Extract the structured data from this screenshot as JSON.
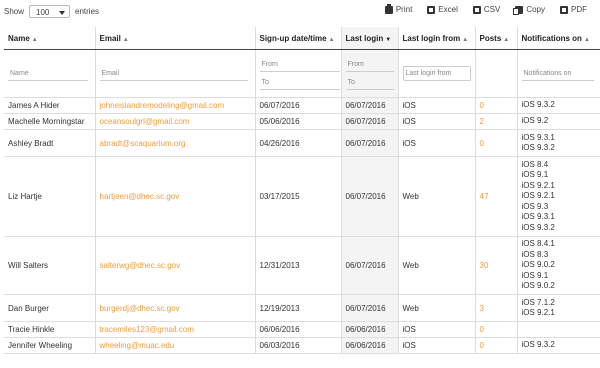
{
  "length_menu": {
    "show_label": "Show",
    "value": "100",
    "entries_label": "entries"
  },
  "toolbar": [
    {
      "icon": "print-icon",
      "label": "Print"
    },
    {
      "icon": "excel-icon",
      "label": "Excel"
    },
    {
      "icon": "csv-icon",
      "label": "CSV"
    },
    {
      "icon": "copy-icon",
      "label": "Copy"
    },
    {
      "icon": "pdf-icon",
      "label": "PDF"
    }
  ],
  "columns": [
    {
      "label": "Name",
      "sort": "▲"
    },
    {
      "label": "Email",
      "sort": "▲"
    },
    {
      "label": "Sign-up date/time",
      "sort": "▲"
    },
    {
      "label": "Last login",
      "sort": "▼"
    },
    {
      "label": "Last login from",
      "sort": "▲"
    },
    {
      "label": "Posts",
      "sort": "▲"
    },
    {
      "label": "Notifications on",
      "sort": "▲"
    }
  ],
  "filters": {
    "name": "Name",
    "email": "Email",
    "signup_from": "From",
    "signup_to": "To",
    "lastlogin_from": "From",
    "lastlogin_to": "To",
    "lastloginfrom": "Last login from",
    "notifications": "Notifications on"
  },
  "rows": [
    {
      "name": "James A Hider",
      "email": "johneislandremodeling@gmail.com",
      "signup": "06/07/2016",
      "last_login": "06/07/2016",
      "from": "iOS",
      "posts": "0",
      "notifs": [
        "iOS 9.3.2"
      ]
    },
    {
      "name": "Machelle Morningstar",
      "email": "oceansoulgrl@gmail.com",
      "signup": "05/06/2016",
      "last_login": "06/07/2016",
      "from": "iOS",
      "posts": "2",
      "notifs": [
        "iOS 9.2"
      ]
    },
    {
      "name": "Ashley Bradt",
      "email": "abradt@scaquarium.org",
      "signup": "04/26/2016",
      "last_login": "06/07/2016",
      "from": "iOS",
      "posts": "0",
      "notifs": [
        "iOS 9.3.1",
        "iOS 9.3.2"
      ]
    },
    {
      "name": "Liz Hartje",
      "email": "hartjeen@dhec.sc.gov",
      "signup": "03/17/2015",
      "last_login": "06/07/2016",
      "from": "Web",
      "posts": "47",
      "notifs": [
        "iOS 8.4",
        "iOS 9.1",
        "iOS 9.2.1",
        "iOS 9.2.1",
        "iOS 9.3",
        "iOS 9.3.1",
        "iOS 9.3.2"
      ]
    },
    {
      "name": "Will Salters",
      "email": "salterwg@dhec.sc.gov",
      "signup": "12/31/2013",
      "last_login": "06/07/2016",
      "from": "Web",
      "posts": "30",
      "notifs": [
        "iOS 8.4.1",
        "iOS 8.3",
        "iOS 9.0.2",
        "iOS 9.1",
        "iOS 9.0.2"
      ]
    },
    {
      "name": "Dan Burger",
      "email": "burgerdj@dhec.sc.gov",
      "signup": "12/19/2013",
      "last_login": "06/07/2016",
      "from": "Web",
      "posts": "3",
      "notifs": [
        "iOS 7.1.2",
        "iOS 9.2.1"
      ]
    },
    {
      "name": "Tracie Hinkle",
      "email": "tracemiles123@gmail.com",
      "signup": "06/06/2016",
      "last_login": "06/06/2016",
      "from": "iOS",
      "posts": "0",
      "notifs": []
    },
    {
      "name": "Jennifer Wheeling",
      "email": "wheeling@muac.edu",
      "signup": "06/03/2016",
      "last_login": "06/06/2016",
      "from": "iOS",
      "posts": "0",
      "notifs": [
        "iOS 9.3.2"
      ]
    }
  ]
}
